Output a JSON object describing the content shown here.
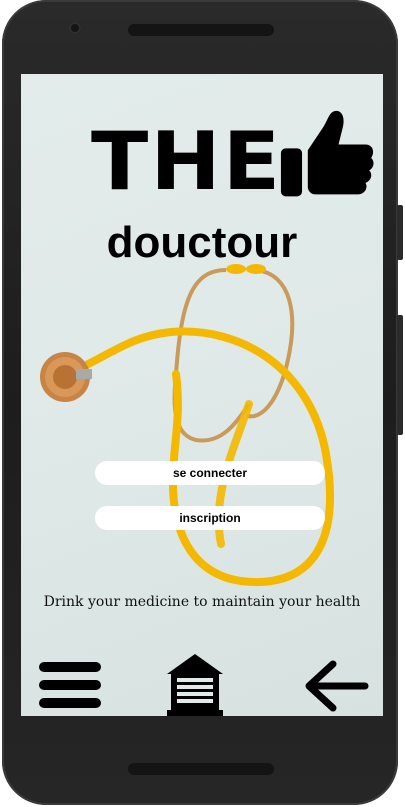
{
  "app": {
    "title_the": "THE",
    "title_sub": "douctour"
  },
  "buttons": {
    "login_label": "se connecter",
    "signup_label": "inscription"
  },
  "tagline": "Drink your medicine to maintain your health",
  "icons": {
    "title": "thumbs-up-icon",
    "nav_left": "menu-icon",
    "nav_center": "home-icon",
    "nav_right": "back-arrow-icon"
  },
  "colors": {
    "stethoscope_tube": "#f5b800",
    "background": "#e0eae8",
    "button_bg": "#ffffff"
  }
}
